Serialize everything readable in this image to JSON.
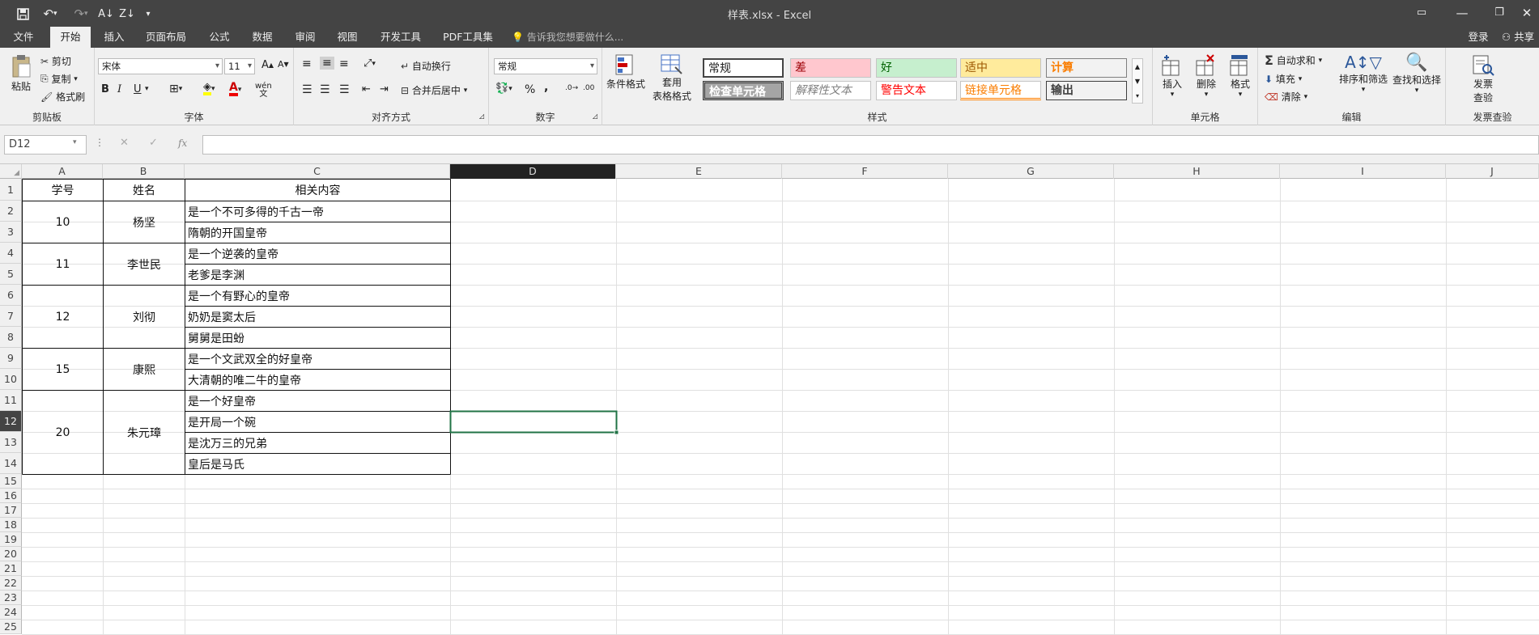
{
  "window": {
    "title": "样表.xlsx - Excel",
    "login": "登录",
    "share": "共享"
  },
  "tabs": [
    "文件",
    "开始",
    "插入",
    "页面布局",
    "公式",
    "数据",
    "审阅",
    "视图",
    "开发工具",
    "PDF工具集"
  ],
  "tell_me": "告诉我您想要做什么...",
  "ribbon": {
    "clipboard": {
      "paste": "粘贴",
      "cut": "剪切",
      "copy": "复制",
      "format_painter": "格式刷",
      "label": "剪贴板"
    },
    "font": {
      "name": "宋体",
      "size": "11",
      "bold": "B",
      "italic": "I",
      "underline": "U",
      "label": "字体"
    },
    "alignment": {
      "wrap": "自动换行",
      "merge": "合并后居中",
      "label": "对齐方式"
    },
    "number": {
      "format": "常规",
      "percent": "%",
      "comma": ",",
      "label": "数字"
    },
    "styles": {
      "conditional": "条件格式",
      "table1": "套用",
      "table2": "表格格式",
      "cells": [
        {
          "name": "常规"
        },
        {
          "name": "差"
        },
        {
          "name": "好"
        },
        {
          "name": "适中"
        },
        {
          "name": "计算"
        },
        {
          "name": "检查单元格"
        },
        {
          "name": "解释性文本"
        },
        {
          "name": "警告文本"
        },
        {
          "name": "链接单元格"
        },
        {
          "name": "输出"
        }
      ],
      "label": "样式"
    },
    "cells": {
      "insert": "插入",
      "delete": "删除",
      "format": "格式",
      "label": "单元格"
    },
    "editing": {
      "autosum": "自动求和",
      "fill": "填充",
      "clear": "清除",
      "sort": "排序和筛选",
      "find": "查找和选择",
      "label": "编辑"
    },
    "invoice": {
      "check1": "发票",
      "check2": "查验",
      "label": "发票查验"
    }
  },
  "formula_bar": {
    "name_box": "D12",
    "fx": "fx",
    "value": ""
  },
  "columns": [
    "A",
    "B",
    "C",
    "D",
    "E",
    "F",
    "G",
    "H",
    "I",
    "J"
  ],
  "rows": [
    "1",
    "2",
    "3",
    "4",
    "5",
    "6",
    "7",
    "8",
    "9",
    "10",
    "11",
    "12",
    "13",
    "14",
    "15",
    "16",
    "17",
    "18",
    "19",
    "20",
    "21",
    "22",
    "23",
    "24",
    "25"
  ],
  "sheet": {
    "headers": [
      "学号",
      "姓名",
      "相关内容"
    ],
    "groups": [
      {
        "id": "10",
        "name": "杨坚",
        "items": [
          "是一个不可多得的千古一帝",
          "隋朝的开国皇帝"
        ]
      },
      {
        "id": "11",
        "name": "李世民",
        "items": [
          "是一个逆袭的皇帝",
          "老爹是李渊"
        ]
      },
      {
        "id": "12",
        "name": "刘彻",
        "items": [
          "是一个有野心的皇帝",
          "奶奶是窦太后",
          "舅舅是田蚡"
        ]
      },
      {
        "id": "15",
        "name": "康熙",
        "items": [
          "是一个文武双全的好皇帝",
          "大清朝的唯二牛的皇帝"
        ]
      },
      {
        "id": "20",
        "name": "朱元璋",
        "items": [
          "是一个好皇帝",
          "是开局一个碗",
          "是沈万三的兄弟",
          "皇后是马氏"
        ]
      }
    ]
  }
}
